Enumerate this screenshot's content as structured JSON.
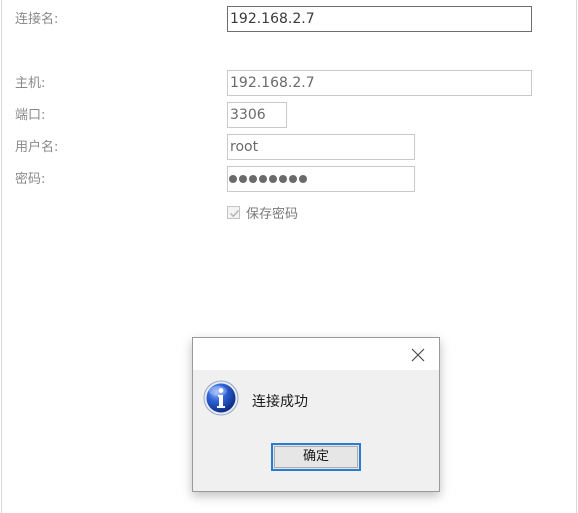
{
  "form": {
    "connection_name_label": "连接名:",
    "connection_name_value": "192.168.2.7",
    "host_label": "主机:",
    "host_value": "192.168.2.7",
    "port_label": "端口:",
    "port_value": "3306",
    "username_label": "用户名:",
    "username_value": "root",
    "password_label": "密码:",
    "password_dot_count": 8,
    "save_password_label": "保存密码",
    "save_password_checked": true
  },
  "dialog": {
    "icon": "info-icon",
    "message": "连接成功",
    "ok_label": "确定",
    "accent_color": "#2a7bd6"
  }
}
